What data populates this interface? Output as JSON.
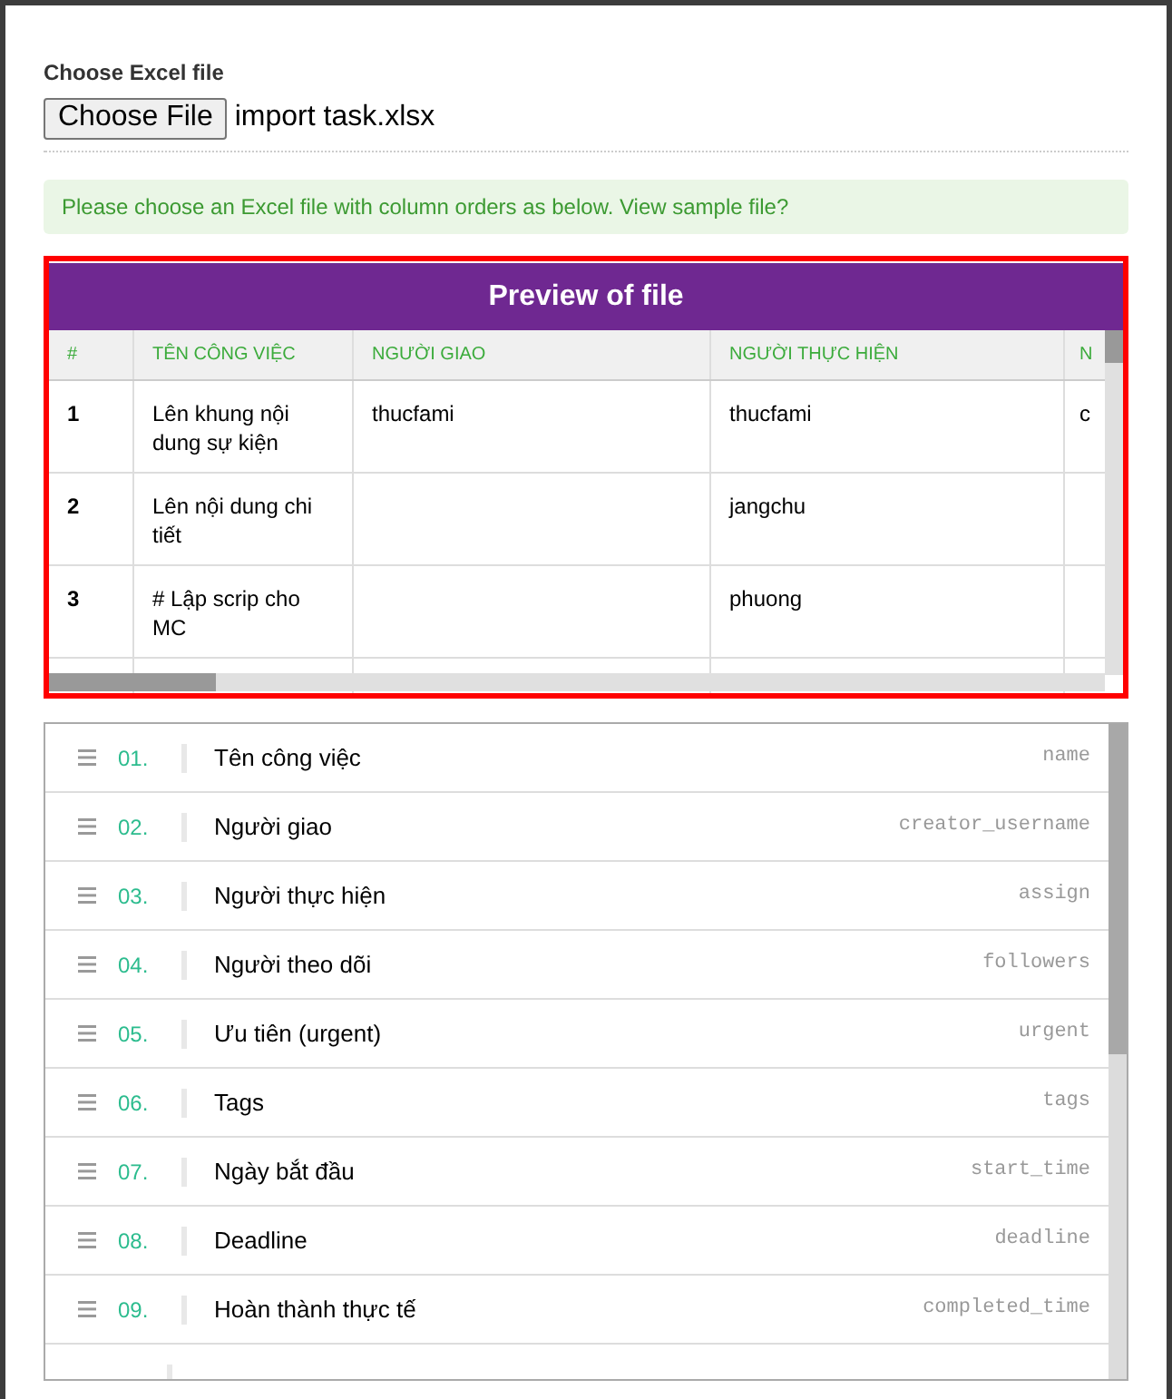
{
  "file_input": {
    "label": "Choose Excel file",
    "button": "Choose File",
    "file_name": "import task.xlsx"
  },
  "notice": "Please choose an Excel file with column orders as below. View sample file?",
  "preview": {
    "title": "Preview of file",
    "columns": [
      "#",
      "TÊN CÔNG VIỆC",
      "NGƯỜI GIAO",
      "NGƯỜI THỰC HIỆN",
      "N"
    ],
    "rows": [
      {
        "cells": [
          "1",
          "Lên khung nội dung sự kiện",
          "thucfami",
          "thucfami",
          "c"
        ]
      },
      {
        "cells": [
          "2",
          "Lên nội dung chi tiết",
          "",
          "jangchu",
          ""
        ]
      },
      {
        "cells": [
          "3",
          "# Lập scrip cho MC",
          "",
          "phuong",
          ""
        ]
      }
    ]
  },
  "fields": [
    {
      "number": "01.",
      "label": "Tên công việc",
      "key": "name"
    },
    {
      "number": "02.",
      "label": "Người giao",
      "key": "creator_username"
    },
    {
      "number": "03.",
      "label": "Người thực hiện",
      "key": "assign"
    },
    {
      "number": "04.",
      "label": "Người theo dõi",
      "key": "followers"
    },
    {
      "number": "05.",
      "label": "Ưu tiên (urgent)",
      "key": "urgent"
    },
    {
      "number": "06.",
      "label": "Tags",
      "key": "tags"
    },
    {
      "number": "07.",
      "label": "Ngày bắt đầu",
      "key": "start_time"
    },
    {
      "number": "08.",
      "label": "Deadline",
      "key": "deadline"
    },
    {
      "number": "09.",
      "label": "Hoàn thành thực tế",
      "key": "completed_time"
    }
  ]
}
